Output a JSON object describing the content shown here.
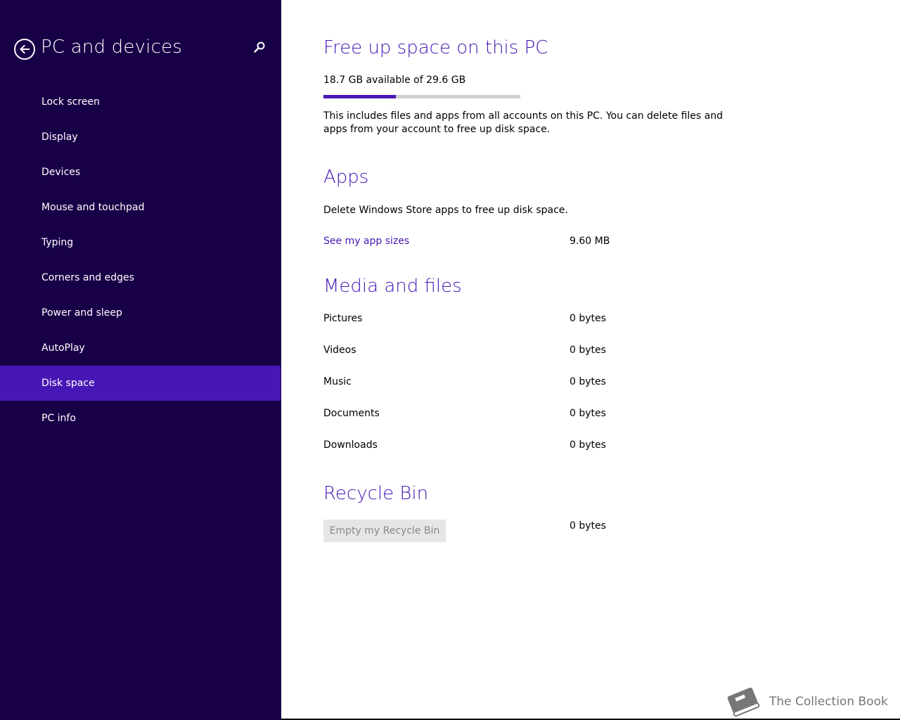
{
  "sidebar": {
    "title": "PC and devices",
    "items": [
      {
        "label": "Lock screen"
      },
      {
        "label": "Display"
      },
      {
        "label": "Devices"
      },
      {
        "label": "Mouse and touchpad"
      },
      {
        "label": "Typing"
      },
      {
        "label": "Corners and edges"
      },
      {
        "label": "Power and sleep"
      },
      {
        "label": "AutoPlay"
      },
      {
        "label": "Disk space"
      },
      {
        "label": "PC info"
      }
    ],
    "active_item": "Disk space",
    "icons": {
      "back": "back-arrow-icon",
      "search": "search-icon"
    }
  },
  "main": {
    "free_space": {
      "title": "Free up space on this PC",
      "summary": "18.7 GB available of 29.6 GB",
      "used_fraction": 0.368,
      "description": "This includes files and apps from all accounts on this PC. You can delete files and apps from your account to free up disk space."
    },
    "apps": {
      "title": "Apps",
      "description": "Delete Windows Store apps to free up disk space.",
      "link_label": "See my app sizes",
      "size": "9.60 MB"
    },
    "media": {
      "title": "Media and files",
      "rows": [
        {
          "label": "Pictures",
          "value": "0 bytes"
        },
        {
          "label": "Videos",
          "value": "0 bytes"
        },
        {
          "label": "Music",
          "value": "0 bytes"
        },
        {
          "label": "Documents",
          "value": "0 bytes"
        },
        {
          "label": "Downloads",
          "value": "0 bytes"
        }
      ]
    },
    "recycle": {
      "title": "Recycle Bin",
      "button_label": "Empty my Recycle Bin",
      "size": "0 bytes"
    }
  },
  "watermark": {
    "text": "The Collection Book",
    "icon": "book-icon"
  },
  "colors": {
    "sidebar_bg": "#180047",
    "accent": "#4617b4"
  }
}
